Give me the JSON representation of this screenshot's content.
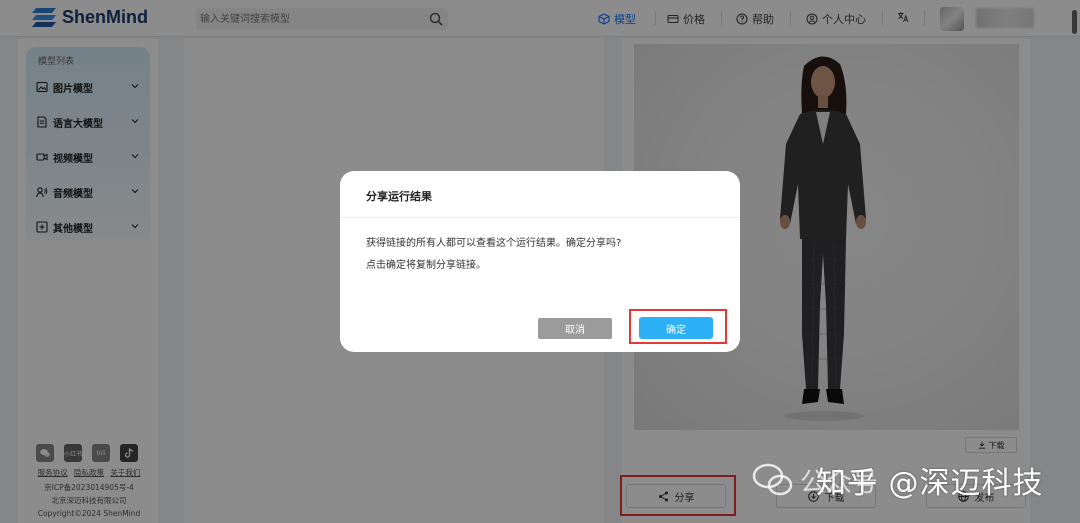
{
  "header": {
    "brand": "ShenMind",
    "search_placeholder": "输入关键词搜索模型",
    "nav": [
      {
        "label": "模型",
        "icon": "cube-icon",
        "active": true
      },
      {
        "label": "价格",
        "icon": "card-icon",
        "active": false
      },
      {
        "label": "帮助",
        "icon": "help-circle-icon",
        "active": false
      },
      {
        "label": "个人中心",
        "icon": "user-circle-icon",
        "active": false
      }
    ],
    "language_icon": "translate-icon",
    "accent_color": "#1677ff"
  },
  "sidebar": {
    "title": "模型列表",
    "items": [
      {
        "label": "图片模型",
        "icon": "image-icon"
      },
      {
        "label": "语言大模型",
        "icon": "document-icon"
      },
      {
        "label": "视频模型",
        "icon": "video-icon"
      },
      {
        "label": "音频模型",
        "icon": "audio-icon"
      },
      {
        "label": "其他模型",
        "icon": "plus-square-icon"
      }
    ],
    "footer": {
      "links": [
        "服务协议",
        "隐私政策",
        "关于我们"
      ],
      "icp": "京ICP备2023014905号-4",
      "company": "北京深迈科技有限公司",
      "copyright": "Copyright©2024 ShenMind"
    }
  },
  "result": {
    "download_small": "下载",
    "actions": {
      "share": "分享",
      "download": "下载",
      "publish": "发布"
    }
  },
  "modal": {
    "title": "分享运行结果",
    "message_line1": "获得链接的所有人都可以查看这个运行结果。确定分享吗?",
    "message_line2": "点击确定将复制分享链接。",
    "cancel": "取消",
    "confirm": "确定",
    "confirm_color": "#2db0f5",
    "highlight_color": "#e53935"
  },
  "watermark": {
    "text": "知乎 @深迈科技",
    "faint": "公众号"
  }
}
